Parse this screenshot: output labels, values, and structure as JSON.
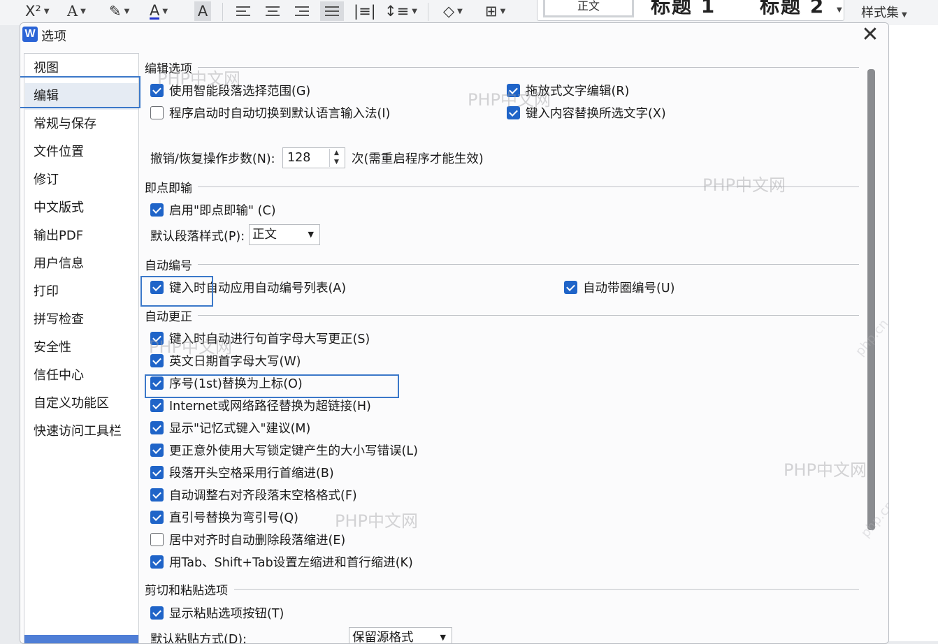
{
  "ribbon": {
    "superscript_label": "X²",
    "style_gallery": {
      "current_style": "正文",
      "heading1": "标题 1",
      "heading2": "标题 2"
    },
    "style_set_label": "样式集"
  },
  "dialog": {
    "title": "选项",
    "app_icon_letter": "W",
    "close_glyph": "✕"
  },
  "nav": {
    "items": [
      {
        "label": "视图"
      },
      {
        "label": "编辑",
        "selected": true
      },
      {
        "label": "常规与保存"
      },
      {
        "label": "文件位置"
      },
      {
        "label": "修订"
      },
      {
        "label": "中文版式"
      },
      {
        "label": "输出PDF"
      },
      {
        "label": "用户信息"
      },
      {
        "label": "打印"
      },
      {
        "label": "拼写检查"
      },
      {
        "label": "安全性"
      },
      {
        "label": "信任中心"
      },
      {
        "label": "自定义功能区"
      },
      {
        "label": "快速访问工具栏"
      }
    ]
  },
  "sections": {
    "edit_options": {
      "title": "编辑选项",
      "smart_paragraph": {
        "label": "使用智能段落选择范围(G)",
        "checked": true
      },
      "drag_drop": {
        "label": "拖放式文字编辑(R)",
        "checked": true
      },
      "auto_switch_ime": {
        "label": "程序启动时自动切换到默认语言输入法(I)",
        "checked": false
      },
      "typing_replaces": {
        "label": "键入内容替换所选文字(X)",
        "checked": true
      },
      "undo_label": "撤销/恢复操作步数(N):",
      "undo_value": "128",
      "undo_note": "次(需重启程序才能生效)"
    },
    "click_and_type": {
      "title": "即点即输",
      "enable": {
        "label": "启用\"即点即输\" (C)",
        "checked": true
      },
      "default_style_label": "默认段落样式(P):",
      "default_style_value": "正文"
    },
    "auto_number": {
      "title": "自动编号",
      "auto_list": {
        "label": "键入时自动应用自动编号列表(A)",
        "checked": true
      },
      "auto_circle": {
        "label": "自动带圈编号(U)",
        "checked": true
      }
    },
    "auto_correct": {
      "title": "自动更正",
      "items": [
        {
          "label": "键入时自动进行句首字母大写更正(S)",
          "checked": true
        },
        {
          "label": "英文日期首字母大写(W)",
          "checked": true
        },
        {
          "label": "序号(1st)替换为上标(O)",
          "checked": true
        },
        {
          "label": "Internet或网络路径替换为超链接(H)",
          "checked": true
        },
        {
          "label": "显示\"记忆式键入\"建议(M)",
          "checked": true
        },
        {
          "label": "更正意外使用大写锁定键产生的大小写错误(L)",
          "checked": true
        },
        {
          "label": "段落开头空格采用行首缩进(B)",
          "checked": true
        },
        {
          "label": "自动调整右对齐段落末空格格式(F)",
          "checked": true
        },
        {
          "label": "直引号替换为弯引号(Q)",
          "checked": true
        },
        {
          "label": "居中对齐时自动删除段落缩进(E)",
          "checked": false
        },
        {
          "label": "用Tab、Shift+Tab设置左缩进和首行缩进(K)",
          "checked": true
        }
      ]
    },
    "cut_paste": {
      "title": "剪切和粘贴选项",
      "show_paste_btn": {
        "label": "显示粘贴选项按钮(T)",
        "checked": true
      },
      "default_paste_label": "默认粘贴方式(D):",
      "default_paste_value": "保留源格式"
    }
  },
  "watermarks": {
    "text": "PHP中文网",
    "rotated_text": "php.cn"
  }
}
